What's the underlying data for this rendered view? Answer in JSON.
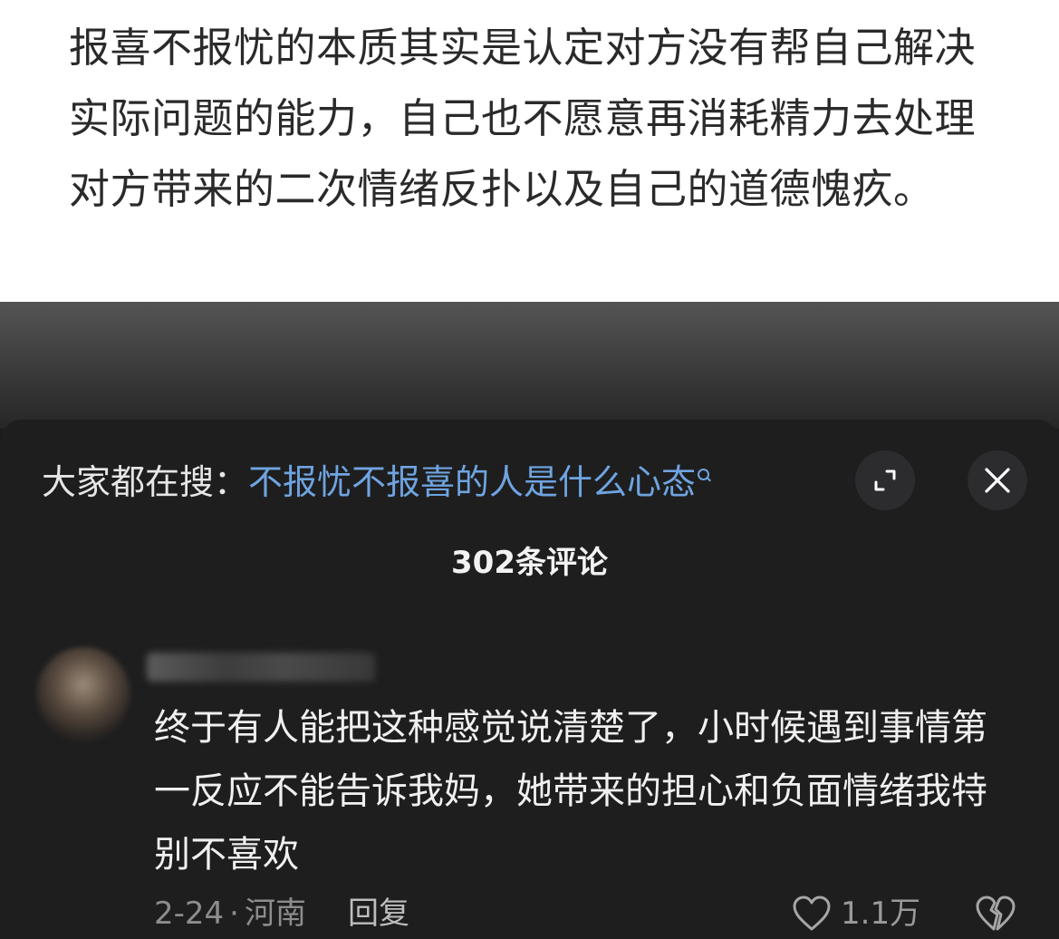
{
  "article": {
    "text": "报喜不报忧的本质其实是认定对方没有帮自己解决实际问题的能力，自己也不愿意再消耗精力去处理对方带来的二次情绪反扑以及自己的道德愧疚。"
  },
  "sheet": {
    "search_prefix": "大家都在搜：",
    "search_query": "不报忧不报喜的人是什么心态",
    "comment_count": "302条评论"
  },
  "comment": {
    "text": "终于有人能把这种感觉说清楚了，小时候遇到事情第一反应不能告诉我妈，她带来的担心和负面情绪我特别不喜欢",
    "date": "2-24",
    "separator": "·",
    "location": "河南",
    "reply_label": "回复",
    "likes": "1.1万"
  },
  "icons": {
    "search": "search-icon",
    "expand": "expand-icon",
    "close": "close-icon",
    "like": "heart-icon",
    "dislike": "broken-heart-icon"
  },
  "colors": {
    "link_blue": "#6fa4e0",
    "sheet_bg": "#1e1e1f",
    "article_bg": "#ffffff"
  }
}
